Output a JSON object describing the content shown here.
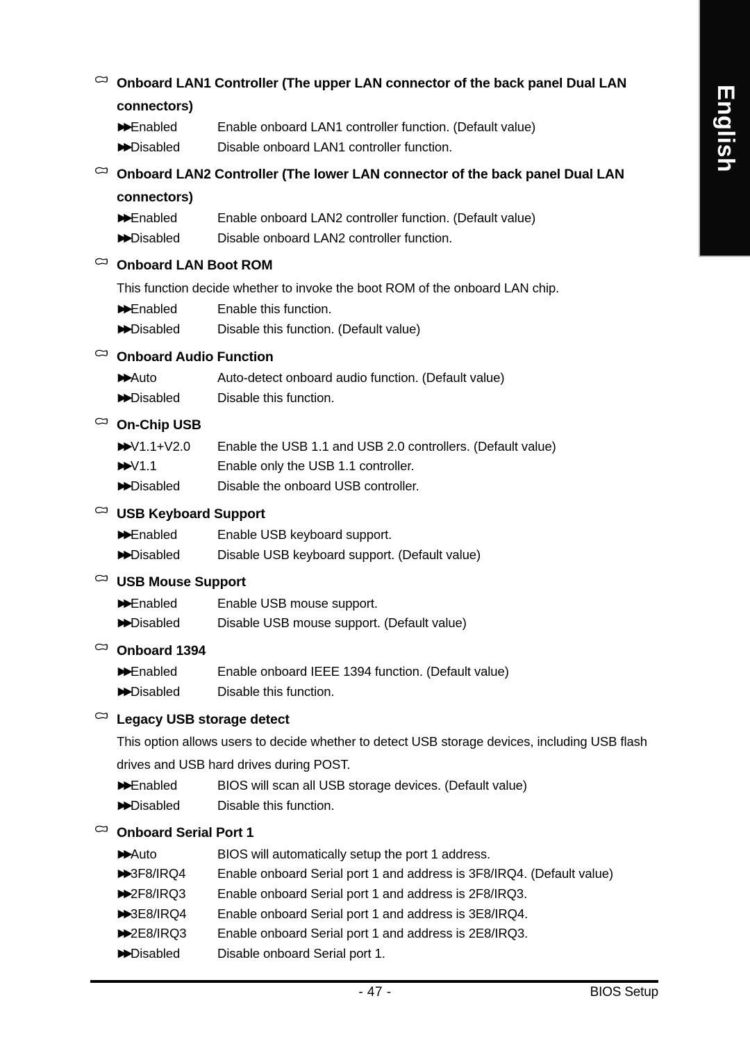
{
  "language_tab": {
    "label": "English"
  },
  "footer": {
    "page_number": "- 47 -",
    "section_name": "BIOS Setup"
  },
  "icons": {
    "heading_bullet": "pointing-hand-icon",
    "option_bullet": "double-right-arrow-icon",
    "option_bullet_glyph": "▶▶"
  },
  "sections": [
    {
      "title": "Onboard LAN1 Controller (The upper LAN connector of the back panel Dual LAN connectors)",
      "paragraph": "",
      "options": [
        {
          "label": "Enabled",
          "desc": "Enable onboard LAN1 controller function. (Default value)"
        },
        {
          "label": "Disabled",
          "desc": "Disable onboard LAN1 controller function."
        }
      ]
    },
    {
      "title": "Onboard LAN2 Controller (The lower LAN connector of the back panel Dual LAN connectors)",
      "paragraph": "",
      "options": [
        {
          "label": "Enabled",
          "desc": "Enable onboard LAN2 controller function. (Default value)"
        },
        {
          "label": "Disabled",
          "desc": "Disable onboard LAN2 controller function."
        }
      ]
    },
    {
      "title": "Onboard LAN Boot ROM",
      "paragraph": "This function decide whether to invoke the boot ROM of the onboard LAN chip.",
      "options": [
        {
          "label": "Enabled",
          "desc": "Enable this function."
        },
        {
          "label": "Disabled",
          "desc": "Disable this function. (Default value)"
        }
      ]
    },
    {
      "title": "Onboard Audio Function",
      "paragraph": "",
      "options": [
        {
          "label": "Auto",
          "desc": "Auto-detect onboard audio function. (Default value)"
        },
        {
          "label": "Disabled",
          "desc": "Disable this function."
        }
      ]
    },
    {
      "title": "On-Chip USB",
      "paragraph": "",
      "options": [
        {
          "label": "V1.1+V2.0",
          "desc": "Enable the USB 1.1 and USB 2.0 controllers. (Default value)"
        },
        {
          "label": "V1.1",
          "desc": "Enable only the USB 1.1 controller."
        },
        {
          "label": "Disabled",
          "desc": "Disable the onboard USB controller."
        }
      ]
    },
    {
      "title": "USB Keyboard Support",
      "paragraph": "",
      "options": [
        {
          "label": "Enabled",
          "desc": "Enable USB keyboard support."
        },
        {
          "label": "Disabled",
          "desc": "Disable USB keyboard support. (Default value)"
        }
      ]
    },
    {
      "title": "USB Mouse Support",
      "paragraph": "",
      "options": [
        {
          "label": "Enabled",
          "desc": "Enable USB mouse support."
        },
        {
          "label": "Disabled",
          "desc": "Disable USB mouse support. (Default value)"
        }
      ]
    },
    {
      "title": "Onboard 1394",
      "paragraph": "",
      "options": [
        {
          "label": "Enabled",
          "desc": "Enable onboard IEEE 1394 function. (Default value)"
        },
        {
          "label": "Disabled",
          "desc": "Disable this function."
        }
      ]
    },
    {
      "title": "Legacy USB storage detect",
      "paragraph": "This option allows users to decide whether to detect USB storage devices, including USB flash drives and USB hard drives during POST.",
      "options": [
        {
          "label": "Enabled",
          "desc": "BIOS will scan all USB storage devices. (Default value)"
        },
        {
          "label": "Disabled",
          "desc": "Disable this function."
        }
      ]
    },
    {
      "title": "Onboard Serial Port 1",
      "paragraph": "",
      "options": [
        {
          "label": "Auto",
          "desc": "BIOS will automatically setup the port 1 address."
        },
        {
          "label": "3F8/IRQ4",
          "desc": "Enable onboard Serial port 1 and address is 3F8/IRQ4. (Default value)"
        },
        {
          "label": "2F8/IRQ3",
          "desc": "Enable onboard Serial port 1 and address is 2F8/IRQ3."
        },
        {
          "label": "3E8/IRQ4",
          "desc": "Enable onboard Serial port 1 and address is 3E8/IRQ4."
        },
        {
          "label": "2E8/IRQ3",
          "desc": "Enable onboard Serial port 1 and address is 2E8/IRQ3."
        },
        {
          "label": "Disabled",
          "desc": "Disable onboard Serial port 1."
        }
      ]
    }
  ]
}
